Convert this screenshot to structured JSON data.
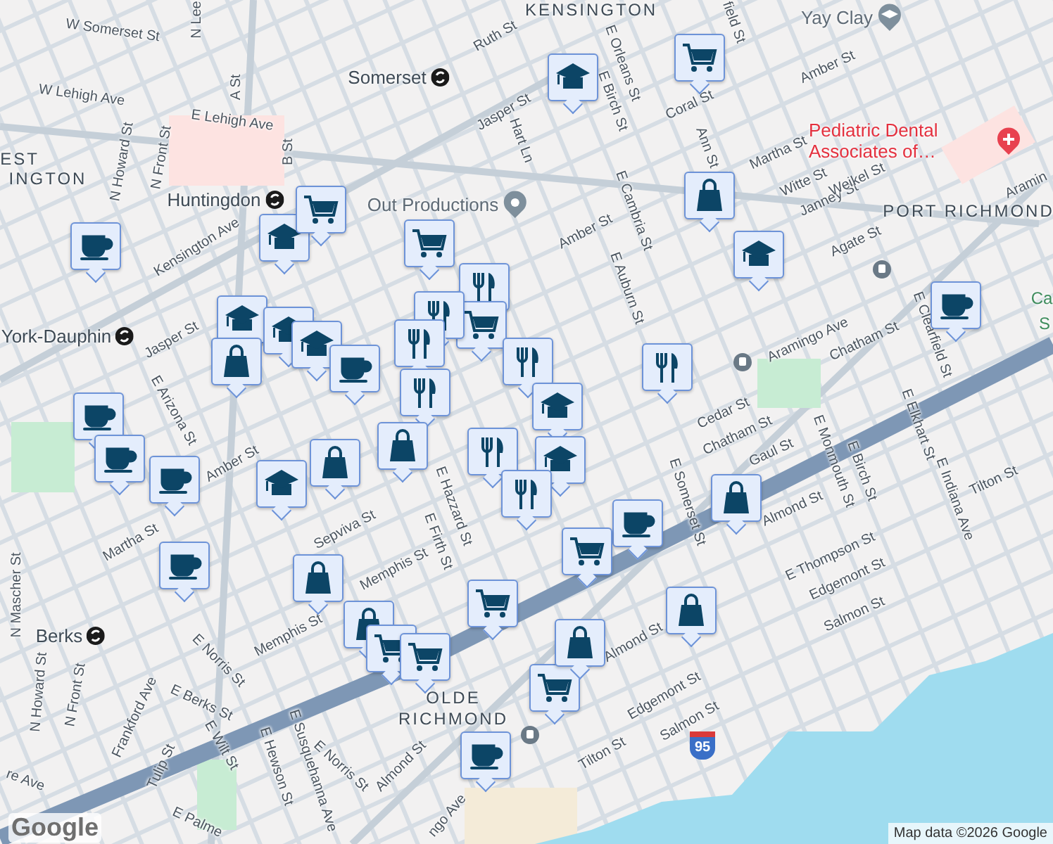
{
  "map": {
    "places": [
      {
        "text": "KENSINGTON",
        "kind": "area"
      },
      {
        "text": "EST",
        "kind": "area"
      },
      {
        "text": "INGTON",
        "kind": "area"
      },
      {
        "text": "PORT RICHMOND",
        "kind": "area"
      },
      {
        "text": "OLDE",
        "kind": "area"
      },
      {
        "text": "RICHMOND",
        "kind": "area"
      },
      {
        "text": "Somerset",
        "kind": "station"
      },
      {
        "text": "Huntingdon",
        "kind": "station"
      },
      {
        "text": "York-Dauphin",
        "kind": "station"
      },
      {
        "text": "Berks",
        "kind": "station"
      },
      {
        "text": "Yay Clay",
        "kind": "school"
      },
      {
        "text": "Pediatric Dental Associates of…",
        "kind": "hospital"
      },
      {
        "text": "Out Productions",
        "kind": "place"
      },
      {
        "text": "Ca",
        "kind": "park"
      },
      {
        "text": "S",
        "kind": "park"
      }
    ],
    "streets": [
      "W Somerset St",
      "N Lee",
      "W Lehigh Ave",
      "E Lehigh Ave",
      "A St",
      "B St",
      "N Howard St",
      "N Front St",
      "Ruth St",
      "Jasper St",
      "Hart Ln",
      "E Orleans St",
      "E Birch St",
      "field St",
      "Coral St",
      "Amber St",
      "Ann St",
      "Martha St",
      "Witte St",
      "Janney St",
      "Weikel St",
      "E Cambria St",
      "Amber St",
      "E Auburn St",
      "Agate St",
      "Aramingo Ave",
      "Aramin",
      "Chatham St",
      "E Clearfield St",
      "Cedar St",
      "Chatham St",
      "Gaul St",
      "Almond St",
      "E Monmouth St",
      "E Birch St",
      "E Elkhart St",
      "E Indiana Ave",
      "Tilton St",
      "E Thompson St",
      "Edgemont St",
      "Salmon St",
      "Almond St",
      "Edgemont St",
      "Salmon St",
      "Tilton St",
      "E Hazzard St",
      "E Firth St",
      "Sepviva St",
      "Memphis St",
      "Memphis St",
      "E Norris St",
      "E Berks St",
      "E Wilt St",
      "E Hewson St",
      "E Susquehanna Ave",
      "E Norris St",
      "Almond St",
      "Frankford Ave",
      "Tulip St",
      "N Mascher St",
      "N Howard St",
      "N Front St",
      "Jasper St",
      "E Arizona St",
      "Amber St",
      "Martha St",
      "Kensington Ave",
      "E Somerset St",
      "re Ave",
      "E Palme",
      "ngo Ave"
    ],
    "markers": [
      {
        "kind": "cafe"
      },
      {
        "kind": "school"
      },
      {
        "kind": "grocery"
      },
      {
        "kind": "grocery"
      },
      {
        "kind": "school"
      },
      {
        "kind": "grocery"
      },
      {
        "kind": "shop"
      },
      {
        "kind": "school"
      },
      {
        "kind": "cafe"
      },
      {
        "kind": "school"
      },
      {
        "kind": "school"
      },
      {
        "kind": "school"
      },
      {
        "kind": "shop"
      },
      {
        "kind": "cafe"
      },
      {
        "kind": "restaurant"
      },
      {
        "kind": "grocery"
      },
      {
        "kind": "restaurant"
      },
      {
        "kind": "restaurant"
      },
      {
        "kind": "restaurant"
      },
      {
        "kind": "restaurant"
      },
      {
        "kind": "school"
      },
      {
        "kind": "shop"
      },
      {
        "kind": "restaurant"
      },
      {
        "kind": "school"
      },
      {
        "kind": "restaurant"
      },
      {
        "kind": "cafe"
      },
      {
        "kind": "cafe"
      },
      {
        "kind": "cafe"
      },
      {
        "kind": "school"
      },
      {
        "kind": "shop"
      },
      {
        "kind": "cafe"
      },
      {
        "kind": "cafe"
      },
      {
        "kind": "grocery"
      },
      {
        "kind": "shop"
      },
      {
        "kind": "restaurant"
      },
      {
        "kind": "shop"
      },
      {
        "kind": "shop"
      },
      {
        "kind": "shop"
      },
      {
        "kind": "grocery"
      },
      {
        "kind": "grocery"
      },
      {
        "kind": "grocery"
      },
      {
        "kind": "grocery"
      },
      {
        "kind": "shop"
      },
      {
        "kind": "cafe"
      }
    ],
    "highway_shield": "95",
    "logo": "Google",
    "attribution": "Map data ©2026 Google"
  }
}
